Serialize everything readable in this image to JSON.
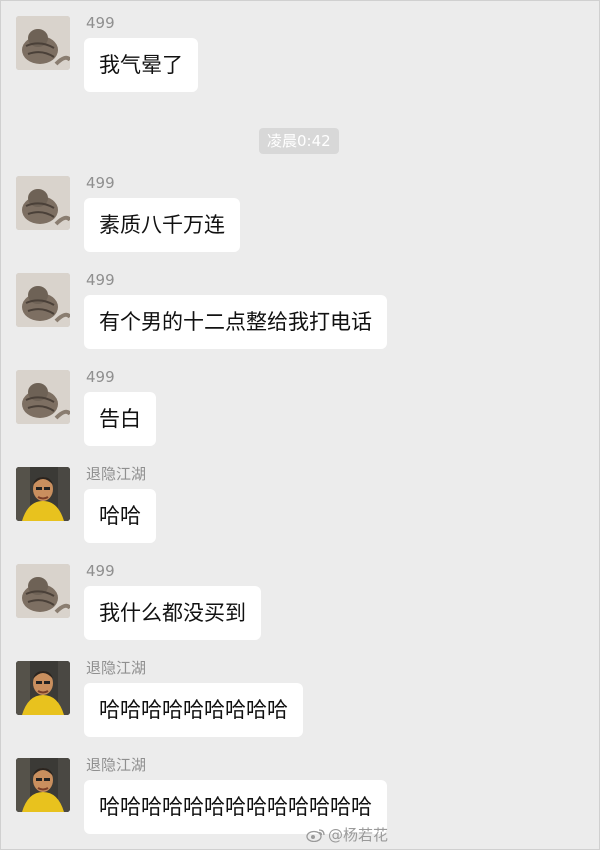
{
  "messages": [
    {
      "sender": "499",
      "avatar": "cat-avatar",
      "text": "我气晕了"
    },
    {
      "sender": "499",
      "avatar": "cat-avatar",
      "text": "素质八千万连"
    },
    {
      "sender": "499",
      "avatar": "cat-avatar",
      "text": "有个男的十二点整给我打电话"
    },
    {
      "sender": "499",
      "avatar": "cat-avatar",
      "text": "告白"
    },
    {
      "sender": "退隐江湖",
      "avatar": "person-avatar",
      "text": "哈哈"
    },
    {
      "sender": "499",
      "avatar": "cat-avatar",
      "text": "我什么都没买到"
    },
    {
      "sender": "退隐江湖",
      "avatar": "person-avatar",
      "text": "哈哈哈哈哈哈哈哈哈"
    },
    {
      "sender": "退隐江湖",
      "avatar": "person-avatar",
      "text": "哈哈哈哈哈哈哈哈哈哈哈哈哈"
    }
  ],
  "timestamp": "凌晨0:42",
  "watermark": "@杨若花",
  "colors": {
    "background": "#ececec",
    "bubble": "#ffffff",
    "timestamp_bg": "#d8d8d8"
  }
}
